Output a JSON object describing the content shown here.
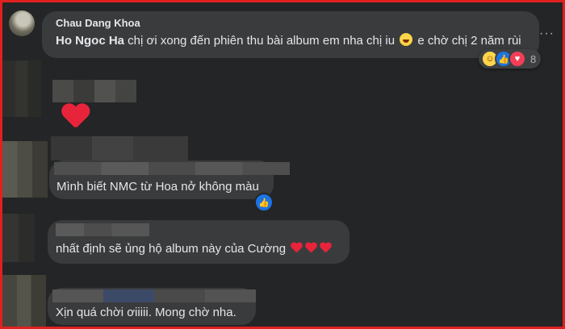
{
  "comments": [
    {
      "author": "Chau Dang Khoa",
      "mention": "Ho Ngoc Ha",
      "text": " chị ơi xong đến phiên thu bài album em nha chị iu ",
      "text_after_emoji": " e chờ chị 2 năm rùi",
      "reaction_count": "8",
      "reactions": [
        "haha",
        "like",
        "love"
      ]
    },
    {
      "text": "Mình biết NMC từ Hoa nở không màu",
      "reactions": [
        "like"
      ]
    },
    {
      "text": "nhất định sẽ ủng hộ album này của Cường"
    },
    {
      "text": "Xịn quá chời ơiiiii. Mong chờ nha."
    }
  ],
  "menu_label": "···",
  "colors": {
    "frame": "#e0201f",
    "bubble": "#3a3b3c",
    "background": "#242526"
  },
  "icons": [
    "more-options-icon",
    "haha-reaction-icon",
    "like-reaction-icon",
    "love-reaction-icon",
    "heart-emoji-icon",
    "laughing-emoji-icon"
  ]
}
